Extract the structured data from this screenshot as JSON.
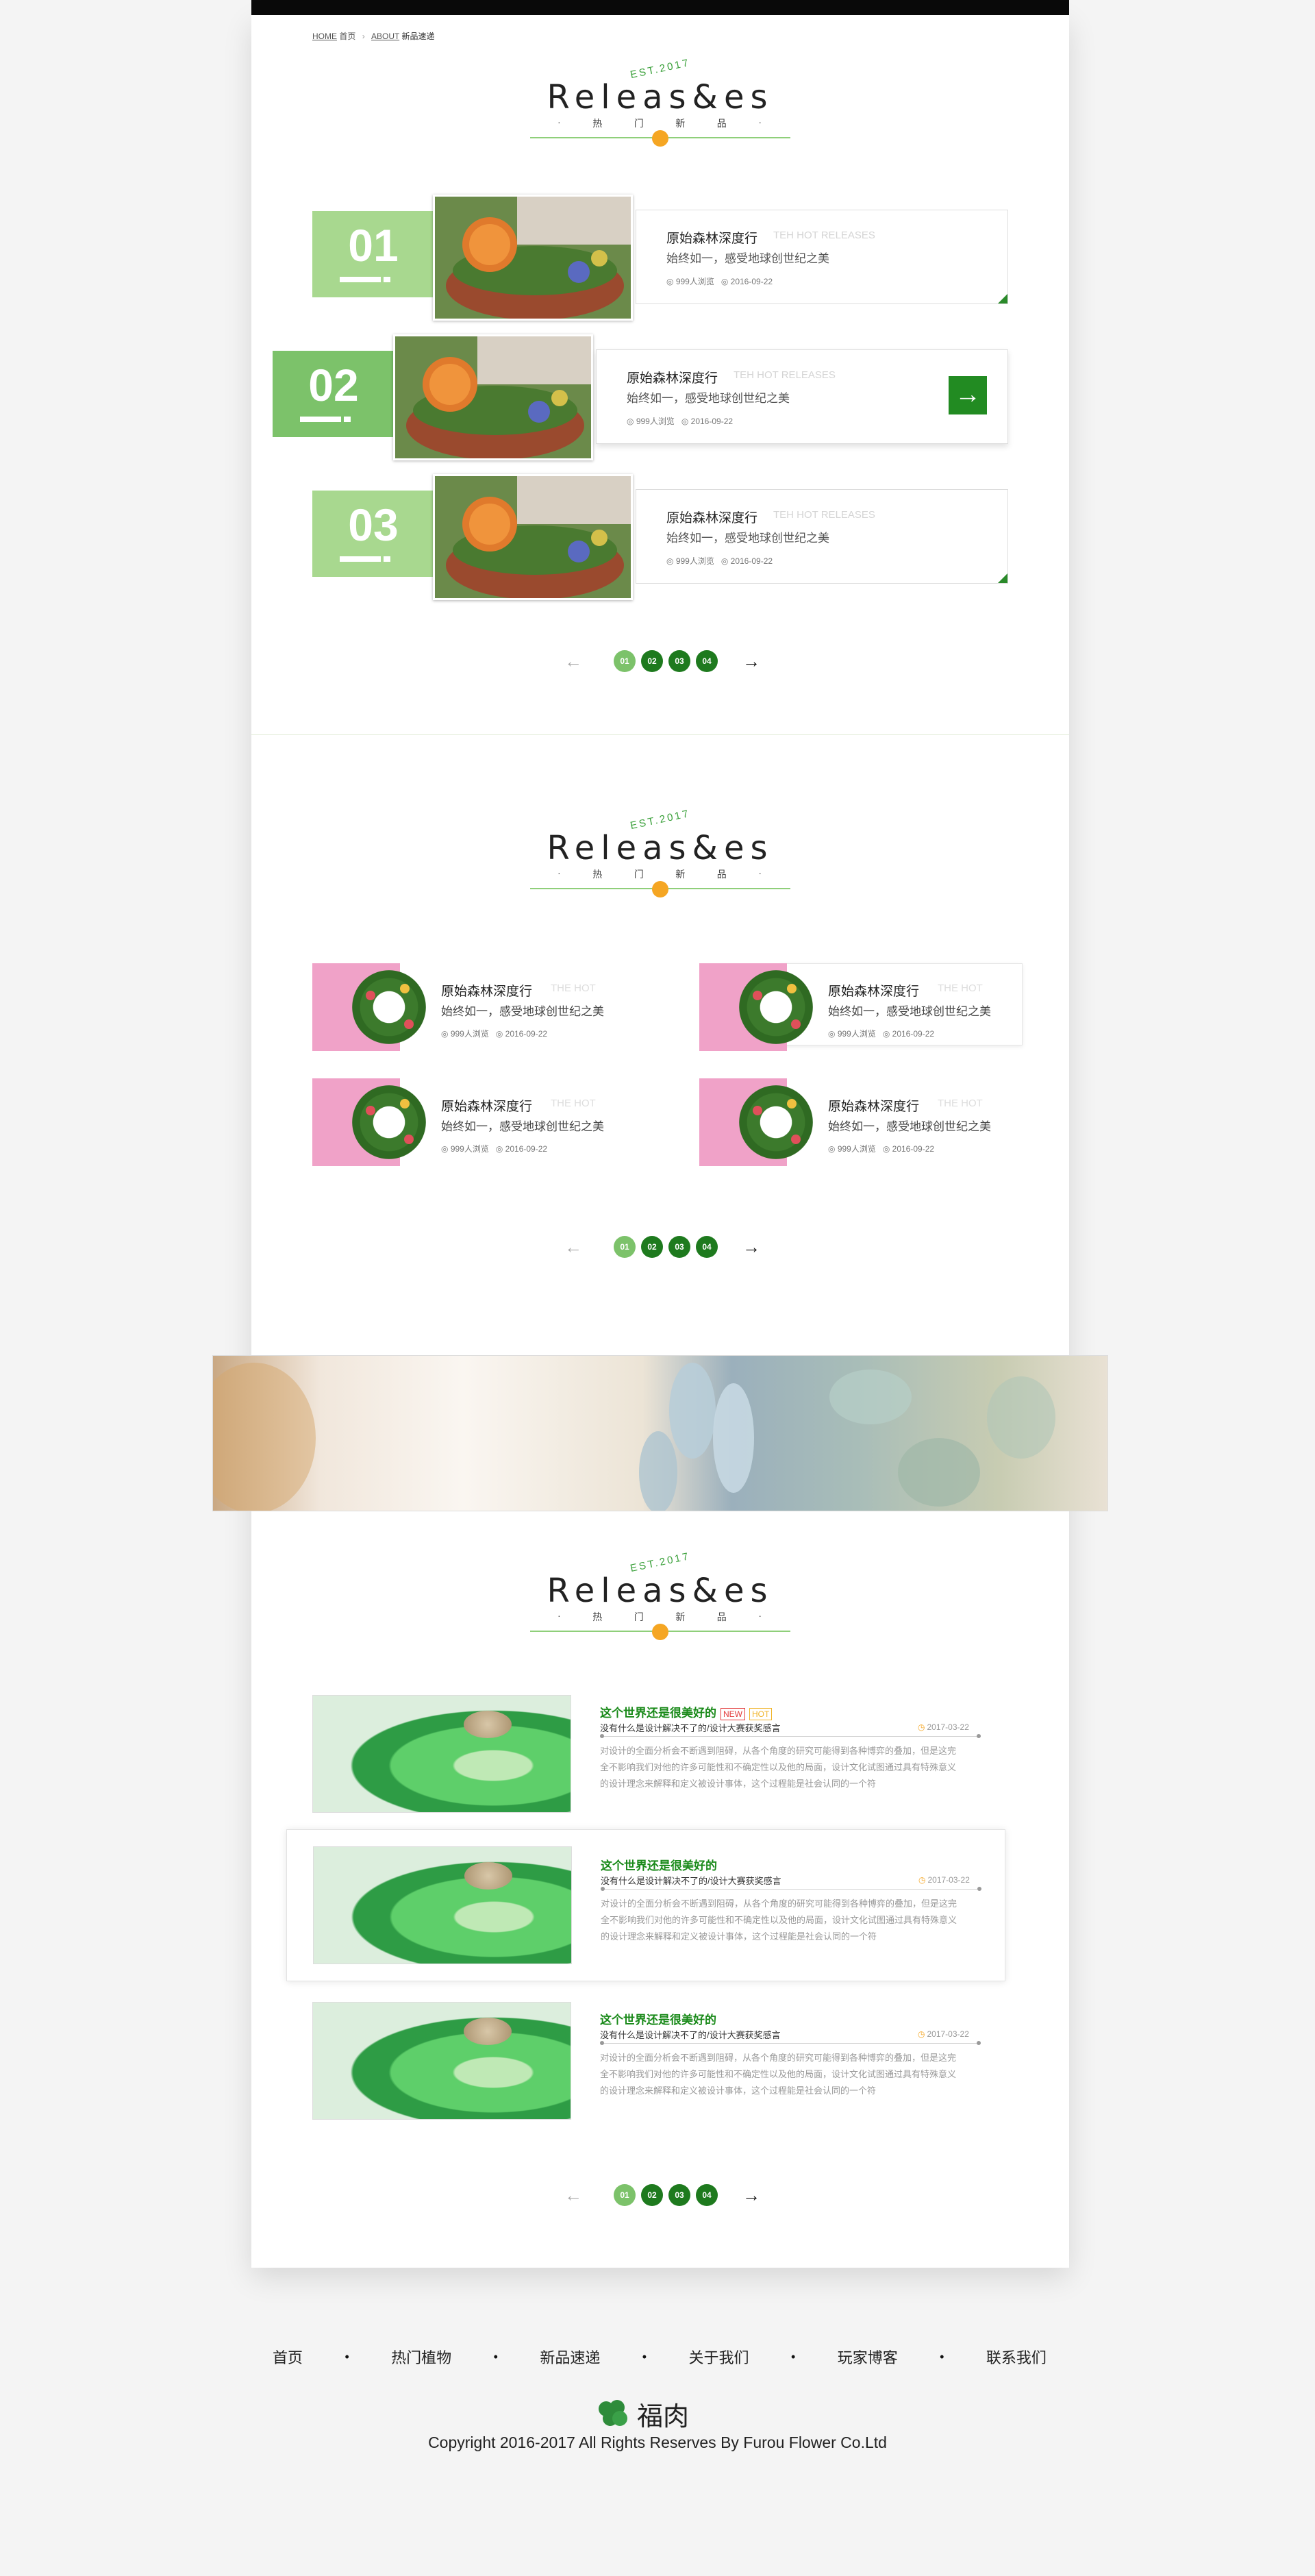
{
  "breadcrumb": {
    "home": "HOME",
    "home_cn": "首页",
    "sep": "›",
    "about": "ABOUT",
    "current": "新品速递"
  },
  "logo": {
    "est": "EST.2017",
    "word": "Releas&es",
    "sub": [
      "·",
      "热",
      "门",
      "新",
      "品",
      "·"
    ]
  },
  "releases": [
    {
      "num": "01",
      "title": "原始森林深度行",
      "en": "TEH HOT RELEASES",
      "desc": "始终如一，感受地球创世纪之美",
      "views": "999人浏览",
      "date": "2016-09-22"
    },
    {
      "num": "02",
      "title": "原始森林深度行",
      "en": "TEH HOT RELEASES",
      "desc": "始终如一，感受地球创世纪之美",
      "views": "999人浏览",
      "date": "2016-09-22",
      "arrow": "→"
    },
    {
      "num": "03",
      "title": "原始森林深度行",
      "en": "TEH HOT RELEASES",
      "desc": "始终如一，感受地球创世纪之美",
      "views": "999人浏览",
      "date": "2016-09-22"
    }
  ],
  "pager": {
    "prev": "←",
    "pages": [
      "01",
      "02",
      "03",
      "04"
    ],
    "next": "→"
  },
  "wreaths": [
    {
      "title": "原始森林深度行",
      "en": "THE HOT",
      "desc": "始终如一，感受地球创世纪之美",
      "views": "999人浏览",
      "date": "2016-09-22"
    },
    {
      "title": "原始森林深度行",
      "en": "THE HOT",
      "desc": "始终如一，感受地球创世纪之美",
      "views": "999人浏览",
      "date": "2016-09-22"
    },
    {
      "title": "原始森林深度行",
      "en": "THE HOT",
      "desc": "始终如一，感受地球创世纪之美",
      "views": "999人浏览",
      "date": "2016-09-22"
    },
    {
      "title": "原始森林深度行",
      "en": "THE HOT",
      "desc": "始终如一，感受地球创世纪之美",
      "views": "999人浏览",
      "date": "2016-09-22"
    }
  ],
  "articles": [
    {
      "title": "这个世界还是很美好的",
      "tag_new": "NEW",
      "tag_hot": "HOT",
      "sub": "没有什么是设计解决不了的/设计大赛获奖感言",
      "date": "2017-03-22",
      "body1": "对设计的全面分析会不断遇到阻碍，从各个角度的研究可能得到各种博弈的叠加，但是这完",
      "body2": "全不影响我们对他的许多可能性和不确定性以及他的局面，设计文化试图通过具有特殊意义",
      "body3": "的设计理念来解释和定义被设计事体，这个过程能是社会认同的一个符"
    },
    {
      "title": "这个世界还是很美好的",
      "sub": "没有什么是设计解决不了的/设计大赛获奖感言",
      "date": "2017-03-22",
      "body1": "对设计的全面分析会不断遇到阻碍，从各个角度的研究可能得到各种博弈的叠加，但是这完",
      "body2": "全不影响我们对他的许多可能性和不确定性以及他的局面，设计文化试图通过具有特殊意义",
      "body3": "的设计理念来解释和定义被设计事体，这个过程能是社会认同的一个符"
    },
    {
      "title": "这个世界还是很美好的",
      "sub": "没有什么是设计解决不了的/设计大赛获奖感言",
      "date": "2017-03-22",
      "body1": "对设计的全面分析会不断遇到阻碍，从各个角度的研究可能得到各种博弈的叠加，但是这完",
      "body2": "全不影响我们对他的许多可能性和不确定性以及他的局面，设计文化试图通过具有特殊意义",
      "body3": "的设计理念来解释和定义被设计事体，这个过程能是社会认同的一个符"
    }
  ],
  "footer": {
    "nav": [
      "首页",
      "热门植物",
      "新品速递",
      "关于我们",
      "玩家博客",
      "联系我们"
    ],
    "bullet": "•",
    "brand": "福肉",
    "copyright": "Copyright 2016-2017 All Rights Reserves By Furou Flower Co.Ltd"
  },
  "colors": {
    "green": "#1e7a1e",
    "light_green": "#a8d88f",
    "pink": "#f0a2c8",
    "orange": "#f5a623"
  }
}
